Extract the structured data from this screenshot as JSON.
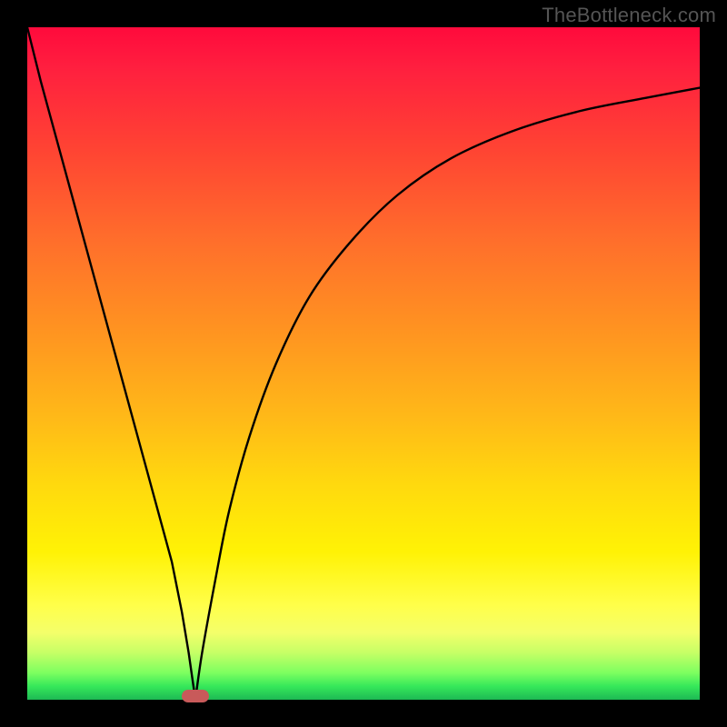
{
  "watermark": "TheBottleneck.com",
  "colors": {
    "frame": "#000000",
    "watermark": "#555555",
    "curve": "#000000",
    "marker": "#c85a5a",
    "gradient_stops": [
      "#ff0a3c",
      "#ff1f3f",
      "#ff4333",
      "#ff6f2b",
      "#ff9620",
      "#ffb918",
      "#ffd90e",
      "#fff205",
      "#ffff4a",
      "#f4ff6a",
      "#c6ff66",
      "#7dff60",
      "#36e85a",
      "#1db954"
    ]
  },
  "chart_data": {
    "type": "line",
    "title": "",
    "xlabel": "",
    "ylabel": "",
    "xlim": [
      0,
      100
    ],
    "ylim": [
      0,
      100
    ],
    "grid": false,
    "legend": false,
    "series": [
      {
        "name": "curve",
        "x": [
          0,
          2,
          5,
          8,
          11,
          14,
          17,
          20,
          21.5,
          23,
          24,
          25,
          26,
          28,
          30,
          33,
          37,
          42,
          48,
          55,
          63,
          72,
          82,
          92,
          100
        ],
        "y": [
          100,
          92,
          81,
          70,
          59,
          48,
          37,
          26,
          20.5,
          13,
          7,
          0,
          7,
          18,
          28,
          39,
          50,
          60,
          68,
          75,
          80.5,
          84.5,
          87.5,
          89.5,
          91
        ]
      }
    ],
    "marker": {
      "x": 25,
      "y": 0
    },
    "notes": "x and y are percentages of the inner plot area (0,0 = bottom-left). The curve is a V shape: a steep linear descent from top-left to ~x=25 where it touches y=0, then a concave-rising curve approaching y≈91 at x=100. Background is a vertical red→green gradient; a small red pill marker sits at the valley."
  }
}
